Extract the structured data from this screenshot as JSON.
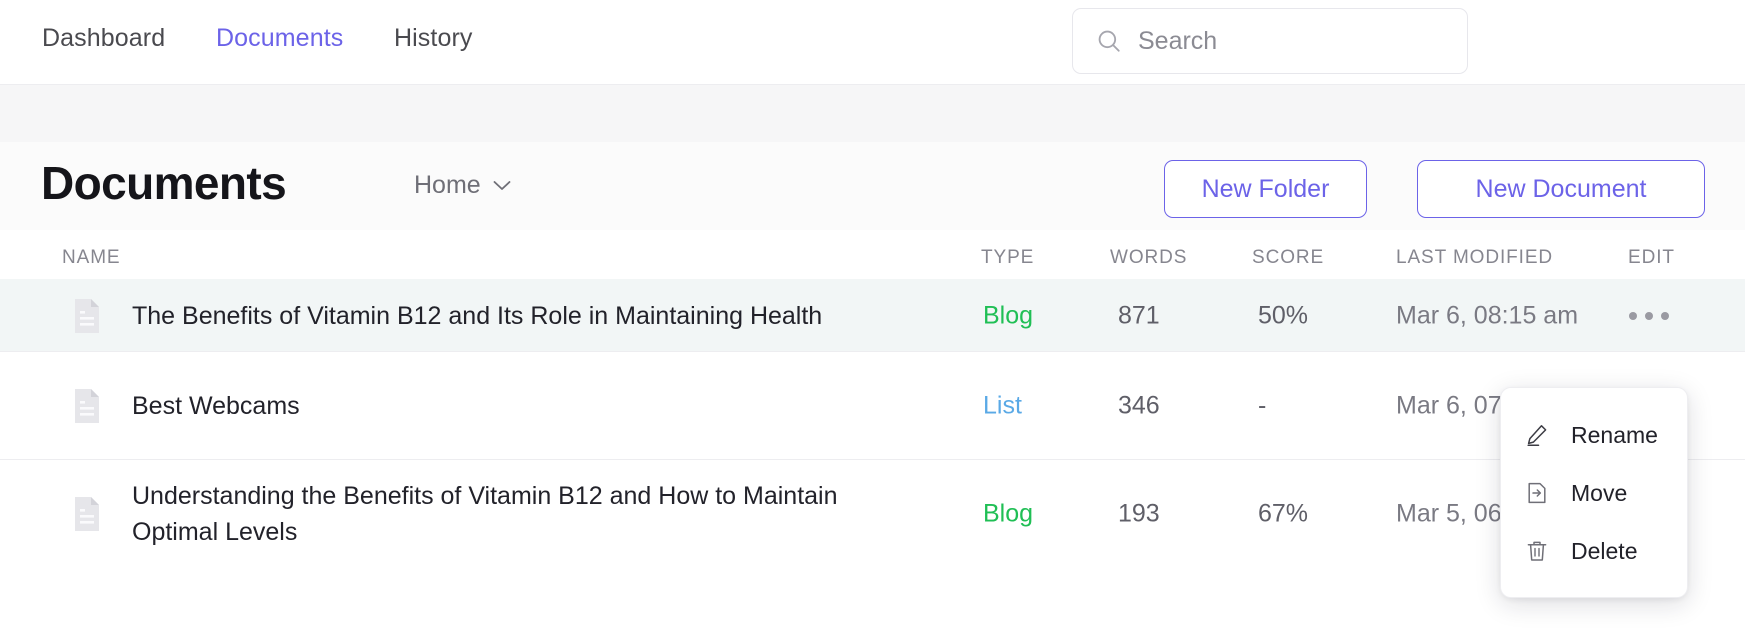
{
  "nav": {
    "items": [
      {
        "label": "Dashboard",
        "active": false
      },
      {
        "label": "Documents",
        "active": true
      },
      {
        "label": "History",
        "active": false
      }
    ]
  },
  "search": {
    "placeholder": "Search",
    "value": "",
    "icon": "search-icon"
  },
  "header": {
    "title": "Documents",
    "breadcrumb": "Home",
    "breadcrumb_icon": "chevron-down-icon",
    "new_folder_label": "New Folder",
    "new_document_label": "New Document"
  },
  "table": {
    "columns": [
      "NAME",
      "TYPE",
      "WORDS",
      "SCORE",
      "LAST MODIFIED",
      "EDIT"
    ],
    "rows": [
      {
        "name": "The Benefits of Vitamin B12 and Its Role in Maintaining Health",
        "type": "Blog",
        "words": "871",
        "score": "50%",
        "modified": "Mar 6, 08:15 am",
        "edit_icon": "ellipsis-icon",
        "file_icon": "document-icon"
      },
      {
        "name": "Best Webcams",
        "type": "List",
        "words": "346",
        "score": "-",
        "modified": "Mar 6, 07",
        "edit_icon": "ellipsis-icon",
        "file_icon": "document-icon"
      },
      {
        "name": "Understanding the Benefits of Vitamin B12 and How to Maintain Optimal Levels",
        "type": "Blog",
        "words": "193",
        "score": "67%",
        "modified": "Mar 5, 06",
        "edit_icon": "ellipsis-icon",
        "file_icon": "document-icon"
      }
    ]
  },
  "context_menu": {
    "items": [
      {
        "label": "Rename",
        "icon": "pencil-icon"
      },
      {
        "label": "Move",
        "icon": "file-move-icon"
      },
      {
        "label": "Delete",
        "icon": "trash-icon"
      }
    ]
  },
  "colors": {
    "accent_purple": "#6c63e8",
    "type_blog": "#20bf55",
    "type_list": "#5aa9e6",
    "row_highlight": "#f2f6f6",
    "text_primary": "#22222a",
    "text_muted": "#86868f"
  }
}
